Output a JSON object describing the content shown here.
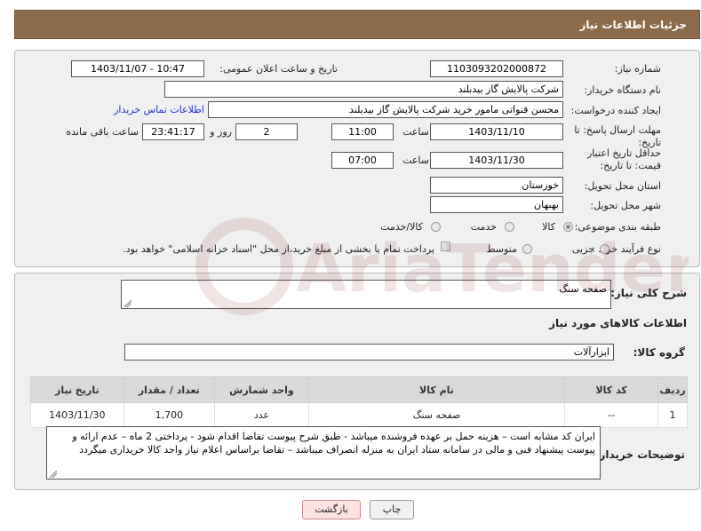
{
  "header": {
    "title": "جزئیات اطلاعات نیاز"
  },
  "form": {
    "need_number_label": "شماره نیاز:",
    "need_number": "1103093202000872",
    "announce_label": "تاریخ و ساعت اعلان عمومی:",
    "announce_value": "1403/11/07 - 10:47",
    "buyer_label": "نام دستگاه خریدار:",
    "buyer_value": "شرکت پالایش گاز بیدبلند",
    "creator_label": "ایجاد کننده درخواست:",
    "creator_value": "محسن قنواتی مامور خرید شرکت پالایش گاز بیدبلند",
    "contact_link": "اطلاعات تماس خریدار",
    "deadline_label": "مهلت ارسال پاسخ: تا تاریخ:",
    "deadline_date": "1403/11/10",
    "time_label": "ساعت",
    "deadline_time": "11:00",
    "days_value": "2",
    "days_label": "روز و",
    "remaining_value": "23:41:17",
    "remaining_label": "ساعت باقی مانده",
    "validity_label": "حداقل تاریخ اعتبار قیمت: تا تاریخ:",
    "validity_date": "1403/11/30",
    "validity_time": "07:00",
    "province_label": "استان محل تحویل:",
    "province_value": "خوزستان",
    "city_label": "شهر محل تحویل:",
    "city_value": "بهبهان",
    "category_label": "طبقه بندی موضوعی:",
    "category_options": [
      "کالا",
      "خدمت",
      "کالا/خدمت"
    ],
    "category_selected": "کالا",
    "process_label": "نوع فرآیند خرید :",
    "process_options": [
      "جزیی",
      "متوسط"
    ],
    "payment_note": "پرداخت تمام یا بخشی از مبلغ خرید،از محل \"اسناد خزانه اسلامی\" خواهد بود."
  },
  "details": {
    "summary_label": "شرح کلی نیاز:",
    "summary_value": "صفحه سنگ",
    "goods_info_title": "اطلاعات کالاهای مورد نیاز",
    "group_label": "گروه کالا:",
    "group_value": "ابزارآلات",
    "table": {
      "headers": [
        "ردیف",
        "کد کالا",
        "نام کالا",
        "واحد شمارش",
        "تعداد / مقدار",
        "تاریخ نیاز"
      ],
      "rows": [
        [
          "1",
          "--",
          "صفحه سنگ",
          "عدد",
          "1,700",
          "1403/11/30"
        ]
      ]
    },
    "buyer_notes_label": "توضیحات خریدار:",
    "buyer_notes_value": "ایران کد مشابه است  – هزینه حمل بر عهده فروشنده میباشد -  طبق شرح پیوست تقاضا اقدام شود - پرداختی 2 ماه – عدم ارائه و پیوست  پیشنهاد فنی و مالی در سامانه ستاد ایران به منزله انصراف میباشد  –  تقاضا براساس اعلام نیاز واحد کالا خریداری میگردد"
  },
  "buttons": {
    "print": "چاپ",
    "back": "بازگشت"
  },
  "watermark": {
    "text": "AriaTender.neT"
  },
  "colors": {
    "header_bg": "#8c6b4a",
    "link": "#2233cc",
    "back_button_bg": "#fde2e2"
  }
}
